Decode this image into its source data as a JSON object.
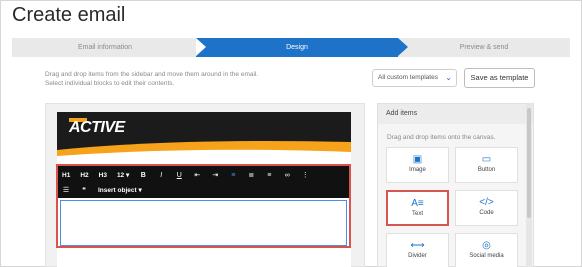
{
  "page": {
    "title": "Create email"
  },
  "stepper": {
    "steps": [
      {
        "label": "Email information",
        "state": "done"
      },
      {
        "label": "Design",
        "state": "active"
      },
      {
        "label": "Preview & send",
        "state": "pending"
      }
    ],
    "active_color": "#1e73c8"
  },
  "helper": {
    "line1": "Drag and drop items from the sidebar and move them around in the email.",
    "line2": "Select individual blocks to edit their contents."
  },
  "templates": {
    "select_value": "All custom templates",
    "save_label": "Save as template"
  },
  "canvas": {
    "logo_text": "ACTIVE",
    "toolbar": {
      "h1": "H1",
      "h2": "H2",
      "h3": "H3",
      "font_size": "12",
      "insert_object": "Insert object"
    }
  },
  "sidebar": {
    "title": "Add items",
    "hint": "Drag and drop items onto the canvas.",
    "items": [
      {
        "label": "Image",
        "icon": "image-icon"
      },
      {
        "label": "Button",
        "icon": "button-icon"
      },
      {
        "label": "Text",
        "icon": "text-icon"
      },
      {
        "label": "Code",
        "icon": "code-icon"
      },
      {
        "label": "Divider",
        "icon": "divider-icon"
      },
      {
        "label": "Social media",
        "icon": "social-media-icon"
      }
    ]
  },
  "colors": {
    "highlight": "#d9534f",
    "accent": "#1e73c8",
    "banner_orange": "#f6a21a"
  }
}
